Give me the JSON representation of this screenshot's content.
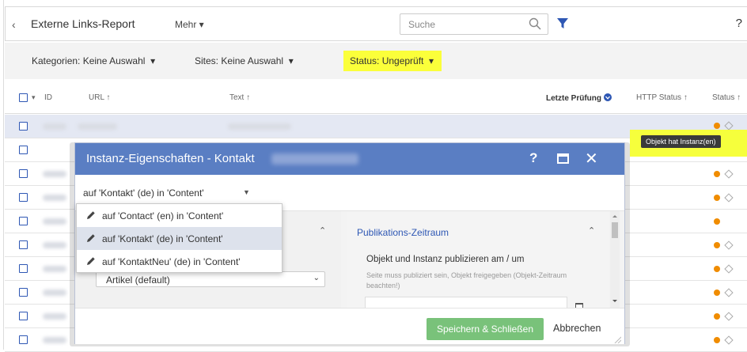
{
  "header": {
    "back_icon": "chevron-left-icon",
    "title": "Externe Links-Report",
    "more_label": "Mehr",
    "search_placeholder": "Suche",
    "help": "?"
  },
  "filters": {
    "categories": "Kategorien: Keine Auswahl",
    "sites": "Sites: Keine Auswahl",
    "status": "Status: Ungeprüft",
    "highlight_color": "#fbff3a"
  },
  "table": {
    "columns": {
      "id": "ID",
      "url": "URL ↑",
      "text": "Text ↑",
      "last_check": "Letzte Prüfung",
      "http_status": "HTTP Status ↑",
      "status": "Status ↑"
    },
    "status_colors": {
      "dot": "#f08c00",
      "diamond": "#aaaaaa"
    }
  },
  "tooltip": "Objekt hat Instanz(en)",
  "dialog": {
    "title": "Instanz-Eigenschaften - Kontakt",
    "help": "?",
    "header_color": "#5a7ec3",
    "selected_instance": "auf 'Kontakt' (de) in 'Content'",
    "menu": [
      {
        "label": "auf 'Contact' (en) in 'Content'",
        "active": false
      },
      {
        "label": "auf 'Kontakt' (de) in 'Content'",
        "active": true
      },
      {
        "label": "auf 'KontaktNeu' (de) in 'Content'",
        "active": false
      }
    ],
    "template_select": "Artikel (default)",
    "section_title": "Publikations-Zeitraum",
    "publish_label": "Objekt und Instanz publizieren am / um",
    "publish_hint": "Seite muss publiziert sein, Objekt freigegeben (Objekt-Zeitraum beachten!)",
    "save_button": "Speichern & Schließen",
    "cancel_button": "Abbrechen",
    "save_color": "#79c27a"
  }
}
